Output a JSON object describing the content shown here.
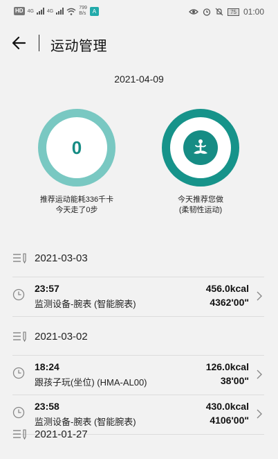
{
  "status_bar": {
    "hd1": "HD",
    "net1": "4G",
    "hd2": "HD",
    "net2": "4G",
    "speed_value": "799",
    "speed_unit": "B/s",
    "app_badge": "A",
    "battery": "75",
    "time": "01:00"
  },
  "header": {
    "title": "运动管理"
  },
  "summary": {
    "date": "2021-04-09",
    "left_ring_value": "0",
    "left_caption_line1": "推荐运动能耗336千卡",
    "left_caption_line2": "今天走了0步",
    "right_caption_line1": "今天推荐您做",
    "right_caption_line2": "(柔韧性运动)",
    "colors": {
      "ring_light": "#79c8c2",
      "ring_dark": "#16938a",
      "accent": "#168c84"
    }
  },
  "records": {
    "groups": [
      {
        "date": "2021-03-03",
        "items": [
          {
            "time": "23:57",
            "device": "监测设备-腕表 (智能腕表)",
            "kcal": "456.0kcal",
            "duration": "4362'00\""
          }
        ]
      },
      {
        "date": "2021-03-02",
        "items": [
          {
            "time": "18:24",
            "device": "跟孩子玩(坐位) (HMA-AL00)",
            "kcal": "126.0kcal",
            "duration": "38'00\""
          },
          {
            "time": "23:58",
            "device": "监测设备-腕表 (智能腕表)",
            "kcal": "430.0kcal",
            "duration": "4106'00\""
          }
        ]
      },
      {
        "date": "2021-01-27",
        "items": []
      }
    ]
  }
}
